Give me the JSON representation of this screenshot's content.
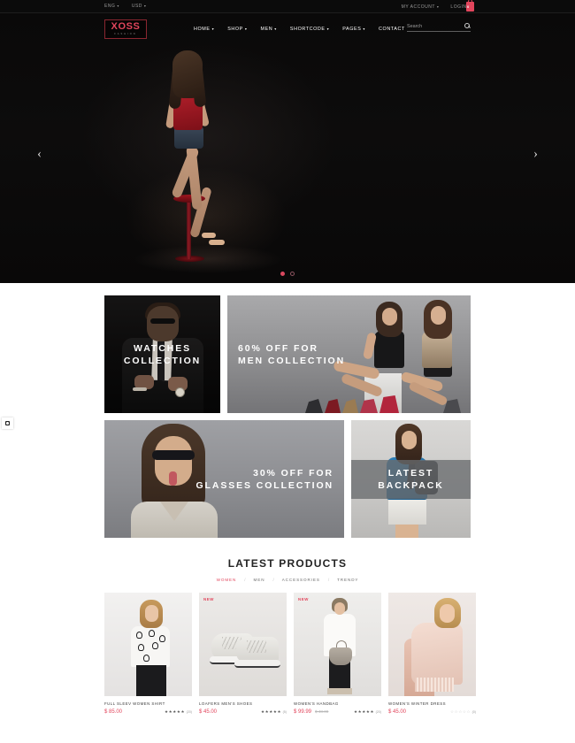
{
  "topbar": {
    "language": "ENG",
    "currency": "USD",
    "my_account": "MY ACCOUNT",
    "login": "LOGIN",
    "cart_count": "0",
    "cart_icon": "shopping-bag-icon",
    "caret": "▾"
  },
  "header": {
    "logo_main": "XOSS",
    "logo_sub": "FASHION",
    "nav": [
      {
        "label": "HOME",
        "has_caret": true
      },
      {
        "label": "SHOP",
        "has_caret": true
      },
      {
        "label": "MEN",
        "has_caret": true
      },
      {
        "label": "SHORTCODE",
        "has_caret": true
      },
      {
        "label": "PAGES",
        "has_caret": true
      },
      {
        "label": "CONTACT",
        "has_caret": false
      }
    ],
    "search_placeholder": "Search",
    "search_value": "",
    "search_icon": "search-icon"
  },
  "hero": {
    "prev_arrow": "‹",
    "next_arrow": "›",
    "slides": 2,
    "active_slide": 1
  },
  "gear_tab": {
    "icon": "gear-icon"
  },
  "promos": [
    {
      "title_line1": "WATCHES",
      "title_line2": "COLLECTION"
    },
    {
      "title_line1": "60% OFF FOR",
      "title_line2": "MEN COLLECTION"
    },
    {
      "title_line1": "30% OFF FOR",
      "title_line2": "GLASSES COLLECTION"
    },
    {
      "title_line1": "LATEST",
      "title_line2": "BACKPACK"
    }
  ],
  "latest": {
    "title": "LATEST PRODUCTS",
    "separator": "/",
    "filters": [
      {
        "label": "WOMEN",
        "active": true
      },
      {
        "label": "MEN",
        "active": false
      },
      {
        "label": "ACCESSORIES",
        "active": false
      },
      {
        "label": "TRENDY",
        "active": false
      }
    ],
    "badge_new": "NEW",
    "star_filled": "★",
    "star_empty": "☆",
    "products": [
      {
        "name": "FULL SLEEV WOMEN SHIRT",
        "price": "$ 85.00",
        "old_price": "",
        "badge": "",
        "stars_filled": 5,
        "rating_count": "(20)"
      },
      {
        "name": "LOAFERS MEN'S SHOES",
        "price": "$ 45.00",
        "old_price": "",
        "badge": "NEW",
        "stars_filled": 5,
        "rating_count": "(5)"
      },
      {
        "name": "WOMEN'S HANDBAG",
        "price": "$ 99.99",
        "old_price": "$ 48.00",
        "badge": "NEW",
        "stars_filled": 5,
        "rating_count": "(20)"
      },
      {
        "name": "WOMEN'S WINTER DRESS",
        "price": "$ 45.00",
        "old_price": "",
        "badge": "",
        "stars_filled": 0,
        "rating_count": "(0)"
      }
    ]
  },
  "colors": {
    "accent": "#e2455c",
    "dark": "#0b0b0b",
    "text": "#3b3b3b"
  }
}
